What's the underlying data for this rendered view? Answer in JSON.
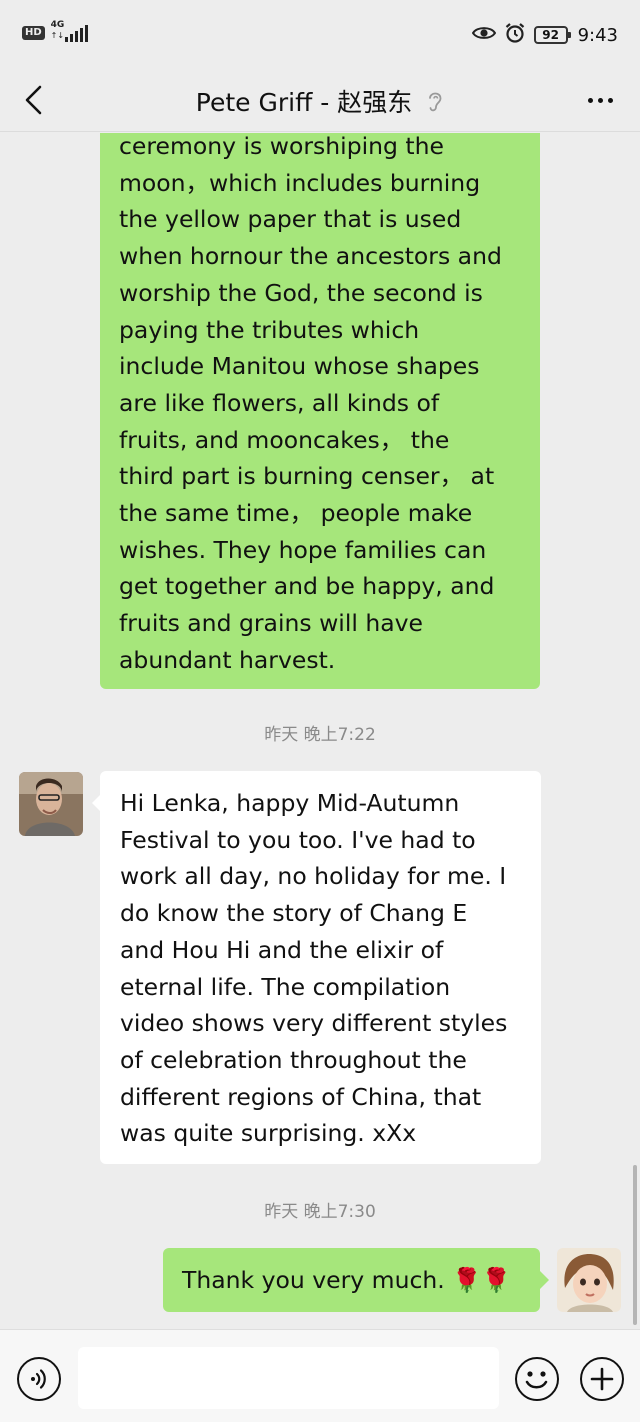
{
  "status_bar": {
    "hd": "HD",
    "network": "4G",
    "battery": "92",
    "time": "9:43"
  },
  "header": {
    "title": "Pete Griff - 赵强东"
  },
  "messages": [
    {
      "side": "right",
      "text": "ceremony is worshiping the\nmoon，which includes burning\nthe yellow paper that is used\nwhen hornour the ancestors and\nworship the God, the second is\npaying the tributes which\ninclude Manitou whose shapes\nare like flowers, all kinds of\nfruits, and mooncakes，  the\nthird part is burning censer，  at\nthe same time，  people make\nwishes. They hope families can\nget together and be happy, and\nfruits and grains will have\nabundant harvest."
    },
    {
      "side": "left",
      "timestamp": "昨天 晚上7:22",
      "text": "Hi Lenka, happy Mid-Autumn\nFestival to you too. I've had to\nwork all day, no holiday for me. I\ndo know the story of Chang E\nand Hou Hi and the elixir of\neternal life. The compilation\nvideo shows very different styles\nof celebration throughout the\ndifferent regions of China, that\nwas quite surprising. xXx"
    },
    {
      "side": "right",
      "timestamp": "昨天 晚上7:30",
      "text": "Thank you very much. 🌹🌹"
    }
  ],
  "input": {
    "value": "",
    "placeholder": ""
  },
  "colors": {
    "background": "#ededed",
    "sent_bubble": "#a6e67b",
    "received_bubble": "#ffffff",
    "timestamp_text": "#8a8a8a"
  },
  "icons": [
    "back-chevron-icon",
    "ear-icon",
    "more-icon",
    "eye-icon",
    "alarm-icon",
    "voice-icon",
    "emoji-icon",
    "plus-icon"
  ]
}
